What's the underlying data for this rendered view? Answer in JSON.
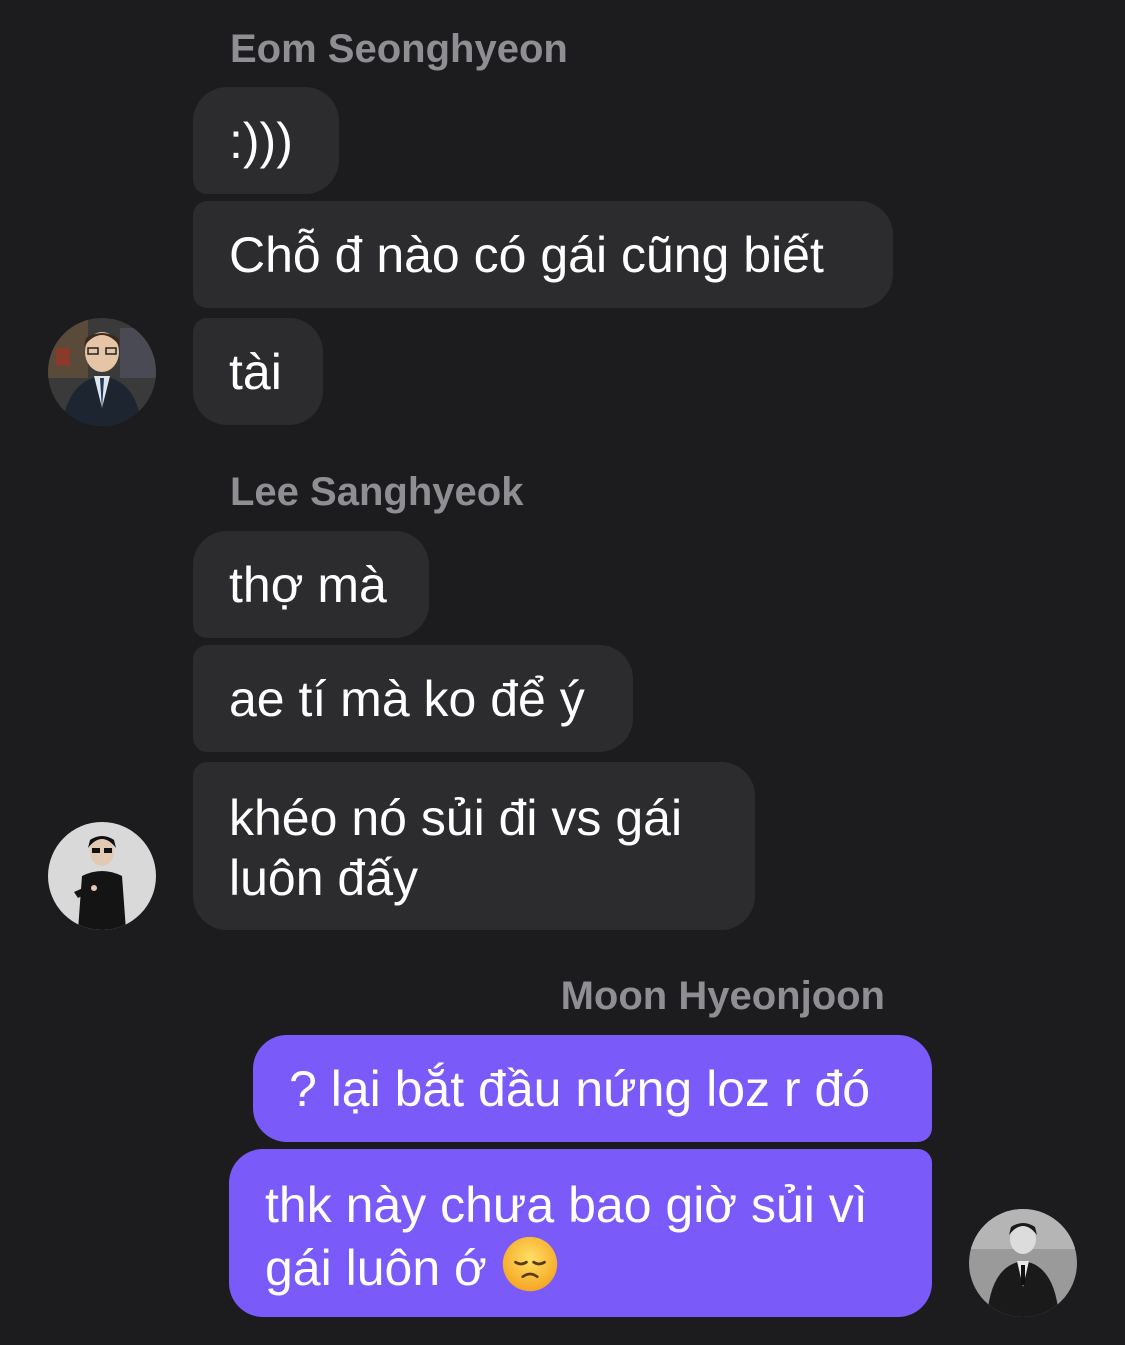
{
  "messages": {
    "group1": {
      "sender": "Eom Seonghyeon",
      "m1": ":)))",
      "m2": "Chỗ đ nào có gái cũng biết",
      "m3": "tài"
    },
    "group2": {
      "sender": "Lee Sanghyeok",
      "m1": "thợ mà",
      "m2": "ae tí mà ko để ý",
      "m3": "khéo nó sủi đi vs gái luôn đấy"
    },
    "group3": {
      "sender": "Moon Hyeonjoon",
      "m1": "? lại bắt đầu nứng loz r đó",
      "m2": "thk này chưa bao giờ sủi vì gái luôn ớ",
      "emoji": "disappointed-face-emoji"
    }
  },
  "avatars": {
    "a1": "user-avatar",
    "a2": "user-avatar",
    "a3": "user-avatar"
  },
  "colors": {
    "background": "#1c1c1e",
    "incoming_bubble": "#2c2c2e",
    "outgoing_bubble": "#7a5af8",
    "sender_name": "#8e8e93"
  }
}
